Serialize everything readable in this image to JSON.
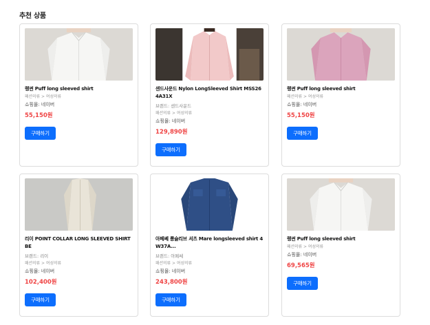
{
  "section": {
    "title": "추천 상품"
  },
  "products": [
    {
      "name": "랭썬 Puff long sleeved shirt",
      "brand": "",
      "category": "패션의류 > 여성의류",
      "mall": "쇼핑몰: 네이버",
      "price": "55,150원",
      "buy_label": "구매하기",
      "image": "white-shirt-photo"
    },
    {
      "name": "샌드사운드 Nylon LongSleeved Shirt MSS264A31X",
      "brand": "브랜드: 샌드사운드",
      "category": "패션의류 > 여성의류",
      "mall": "쇼핑몰: 네이버",
      "price": "129,890원",
      "buy_label": "구매하기",
      "image": "pink-nylon-shirt-photo"
    },
    {
      "name": "랭썬 Puff long sleeved shirt",
      "brand": "",
      "category": "패션의류 > 여성의류",
      "mall": "쇼핑몰: 네이버",
      "price": "55,150원",
      "buy_label": "구매하기",
      "image": "pink-shirt-photo"
    },
    {
      "name": "리이 POINT COLLAR LONG SLEEVED SHIRT BE",
      "brand": "브랜드: 리이",
      "category": "패션의류 > 여성의류",
      "mall": "쇼핑몰: 네이버",
      "price": "102,400원",
      "buy_label": "구매하기",
      "image": "beige-shirt-photo"
    },
    {
      "name": "아페쎄 롱슬리브 셔츠 Mare longsleeved shirt 4W37A...",
      "brand": "브랜드: 아페쎄",
      "category": "패션의류 > 여성의류",
      "mall": "쇼핑몰: 네이버",
      "price": "243,800원",
      "buy_label": "구매하기",
      "image": "denim-shirt-photo"
    },
    {
      "name": "랭썬 Puff long sleeved shirt",
      "brand": "",
      "category": "패션의류 > 여성의류",
      "mall": "쇼핑몰: 네이버",
      "price": "69,565원",
      "buy_label": "구매하기",
      "image": "white-shirt-photo"
    }
  ]
}
